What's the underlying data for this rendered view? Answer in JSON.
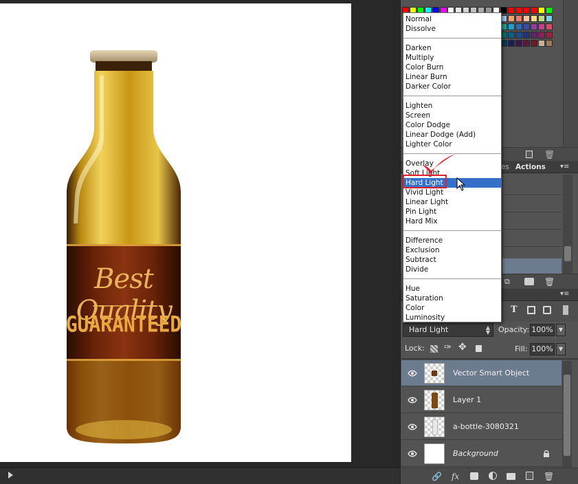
{
  "blend_modes": {
    "groups": [
      [
        "Normal",
        "Dissolve"
      ],
      [
        "Darken",
        "Multiply",
        "Color Burn",
        "Linear Burn",
        "Darker Color"
      ],
      [
        "Lighten",
        "Screen",
        "Color Dodge",
        "Linear Dodge (Add)",
        "Lighter Color"
      ],
      [
        "Overlay",
        "Soft Light",
        "Hard Light",
        "Vivid Light",
        "Linear Light",
        "Pin Light",
        "Hard Mix"
      ],
      [
        "Difference",
        "Exclusion",
        "Subtract",
        "Divide"
      ],
      [
        "Hue",
        "Saturation",
        "Color",
        "Luminosity"
      ]
    ],
    "selected": "Hard Light"
  },
  "menu_labels": {
    "normal": "Normal",
    "dissolve": "Dissolve",
    "darken": "Darken",
    "multiply": "Multiply",
    "color_burn": "Color Burn",
    "linear_burn": "Linear Burn",
    "darker_color": "Darker Color",
    "lighten": "Lighten",
    "screen": "Screen",
    "color_dodge": "Color Dodge",
    "linear_dodge": "Linear Dodge (Add)",
    "lighter_color": "Lighter Color",
    "overlay": "Overlay",
    "soft_light": "Soft Light",
    "hard_light": "Hard Light",
    "vivid_light": "Vivid Light",
    "linear_light": "Linear Light",
    "pin_light": "Pin Light",
    "hard_mix": "Hard Mix",
    "difference": "Difference",
    "exclusion": "Exclusion",
    "subtract": "Subtract",
    "divide": "Divide",
    "hue": "Hue",
    "saturation": "Saturation",
    "color": "Color",
    "luminosity": "Luminosity"
  },
  "panels": {
    "history_tab_fragment": "les",
    "actions_tab": "Actions"
  },
  "layers_panel": {
    "blend_mode_value": "Hard Light",
    "opacity_label": "Opacity:",
    "opacity_value": "100%",
    "lock_label": "Lock:",
    "fill_label": "Fill:",
    "fill_value": "100%",
    "layers": [
      {
        "name": "Vector Smart Object",
        "active": true
      },
      {
        "name": "Layer 1",
        "active": false
      },
      {
        "name": "a-bottle-3080321",
        "active": false
      },
      {
        "name": "Background",
        "active": false,
        "italic": true
      }
    ]
  },
  "artwork": {
    "label_line1": "Best Quality",
    "label_line2": "GUARANTEED"
  },
  "colors": {
    "menu_selected": "#3470c8",
    "active_layer": "#6d7b8f",
    "highlight_box": "#e0202a",
    "checkmark": "#e0202a"
  },
  "icons": {
    "eye": "eye-icon",
    "lock": "lock-icon",
    "text_tool": "T",
    "link": "link-icon",
    "fx": "fx",
    "mask": "mask-icon",
    "adjustment": "adjustment-icon",
    "folder": "folder-icon",
    "new_layer": "new-layer-icon",
    "trash": "trash-icon"
  }
}
